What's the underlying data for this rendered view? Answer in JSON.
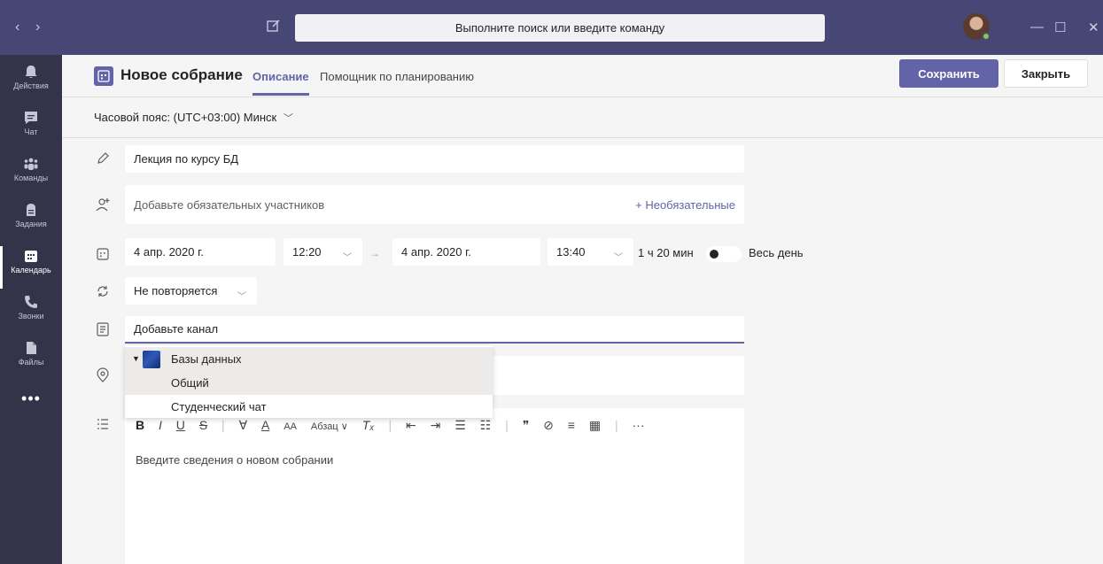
{
  "titlebar": {
    "search_placeholder": "Выполните поиск или введите команду",
    "nav_back": "‹",
    "nav_forward": "›",
    "minimize": "—",
    "maximize": "☐",
    "close": "✕"
  },
  "rail": {
    "items": [
      {
        "label": "Действия",
        "icon": "bell-icon"
      },
      {
        "label": "Чат",
        "icon": "chat-icon"
      },
      {
        "label": "Команды",
        "icon": "teams-icon"
      },
      {
        "label": "Задания",
        "icon": "assignments-icon"
      },
      {
        "label": "Календарь",
        "icon": "calendar-icon",
        "active": true
      },
      {
        "label": "Звонки",
        "icon": "phone-icon"
      },
      {
        "label": "Файлы",
        "icon": "files-icon"
      }
    ],
    "more": "•••"
  },
  "header": {
    "title": "Новое собрание",
    "tabs": [
      "Описание",
      "Помощник по планированию"
    ],
    "active_tab": "Описание",
    "save_label": "Сохранить",
    "close_label": "Закрыть"
  },
  "timezone": "Часовой пояс: (UTC+03:00) Минск",
  "form": {
    "title_value": "Лекция по курсу БД",
    "attendees_placeholder": "Добавьте обязательных участников",
    "optional_label": "+ Необязательные",
    "start_date": "4 апр. 2020 г.",
    "start_time": "12:20",
    "end_date": "4 апр. 2020 г.",
    "end_time": "13:40",
    "duration": "1 ч 20 мин",
    "all_day_label": "Весь день",
    "repeat": "Не повторяется",
    "channel_placeholder": "Добавьте канал",
    "editor_placeholder": "Введите сведения о новом собрании"
  },
  "dropdown": {
    "team": "Базы данных",
    "channels": [
      "Общий",
      "Студенческий чат"
    ]
  },
  "toolbar": {
    "bold": "B",
    "italic": "I",
    "underline": "U",
    "strike": "S",
    "highlight": "∀",
    "font_color": "A",
    "font_size": "AA",
    "paragraph": "Абзац ∨",
    "clear": "Tₓ",
    "outdent": "⇤",
    "indent": "⇥",
    "bullets": "☰",
    "numbered": "☷",
    "quote": "❞",
    "link": "⊘",
    "hr": "≡",
    "table": "▦",
    "more": "···"
  },
  "colors": {
    "brand": "#6264a7",
    "titlebar": "#464775",
    "rail": "#33344a"
  }
}
